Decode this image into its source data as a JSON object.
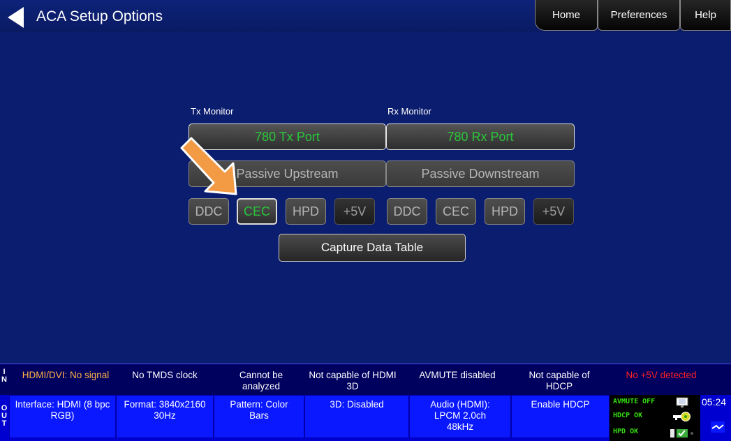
{
  "header": {
    "title": "ACA Setup Options",
    "nav": {
      "home": "Home",
      "preferences": "Preferences",
      "help": "Help"
    }
  },
  "tx": {
    "label": "Tx Monitor",
    "port": "780 Tx Port",
    "passive": "Passive Upstream",
    "ddc": "DDC",
    "cec": "CEC",
    "hpd": "HPD",
    "plus5v": "+5V"
  },
  "rx": {
    "label": "Rx Monitor",
    "port": "780 Rx Port",
    "passive": "Passive Downstream",
    "ddc": "DDC",
    "cec": "CEC",
    "hpd": "HPD",
    "plus5v": "+5V"
  },
  "capture_label": "Capture Data Table",
  "status_in": {
    "side": [
      "I",
      "N"
    ],
    "cells": [
      "HDMI/DVI: No signal",
      "No TMDS clock",
      "Cannot be analyzed",
      "Not capable of HDMI 3D",
      "AVMUTE disabled",
      "Not capable of HDCP",
      "No +5V detected"
    ]
  },
  "status_out": {
    "side": [
      "O",
      "U",
      "T"
    ],
    "cells": [
      "Interface: HDMI (8 bpc RGB)",
      "Format: 3840x2160 30Hz",
      "Pattern: Color Bars",
      "3D: Disabled",
      "Audio (HDMI): LPCM 2.0ch 48kHz",
      "Enable HDCP"
    ],
    "indicators": {
      "avmute": "AVMUTE OFF",
      "hdcp": "HDCP OK",
      "hpd": "HPD OK"
    },
    "clock": "05:24"
  },
  "colors": {
    "background": "#0b1d6e",
    "active_green": "#29c73a",
    "warning_orange": "#ffb347",
    "error_red": "#ff2222",
    "indicator_green": "#35e010"
  },
  "icons": [
    "back-arrow-icon",
    "pointer-arrow-icon",
    "monitor-icon",
    "key-icon",
    "toggle-icon",
    "cable-icon"
  ]
}
